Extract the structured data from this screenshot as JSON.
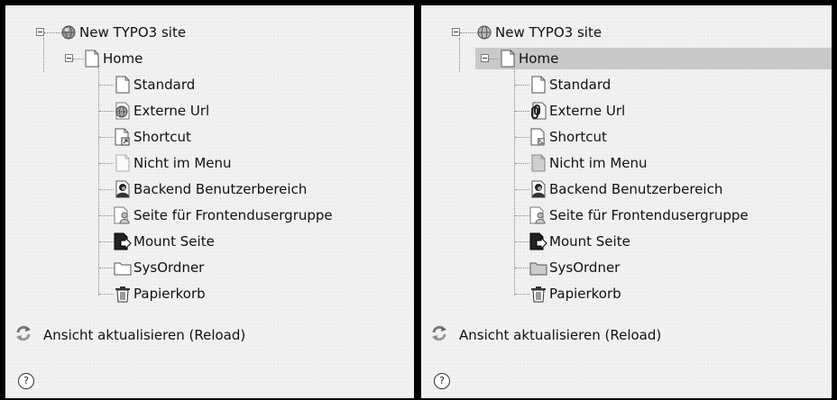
{
  "root": {
    "label": "New TYPO3 site",
    "icon": "globe-icon"
  },
  "home": {
    "label": "Home",
    "icon": "page-icon"
  },
  "pages": [
    {
      "label": "Standard",
      "icon": "page-icon"
    },
    {
      "label": "Externe Url",
      "icon": "external-url-icon"
    },
    {
      "label": "Shortcut",
      "icon": "shortcut-page-icon"
    },
    {
      "label": "Nicht im Menu",
      "icon": "hidden-in-menu-page-icon"
    },
    {
      "label": "Backend Benutzerbereich",
      "icon": "backend-user-section-icon"
    },
    {
      "label": "Seite für Frontendusergruppe",
      "icon": "frontend-usergroup-page-icon"
    },
    {
      "label": "Mount Seite",
      "icon": "mount-page-icon"
    },
    {
      "label": "SysOrdner",
      "icon": "sysfolder-icon"
    },
    {
      "label": "Papierkorb",
      "icon": "recycler-icon"
    }
  ],
  "reload": {
    "label": "Ansicht aktualisieren (Reload)",
    "icon": "refresh-icon"
  },
  "help": {
    "symbol": "?",
    "icon": "help-icon"
  },
  "colors": {
    "panel_bg": "#f1f1f1",
    "highlight": "#c8c8c8",
    "divider": "#000000"
  }
}
